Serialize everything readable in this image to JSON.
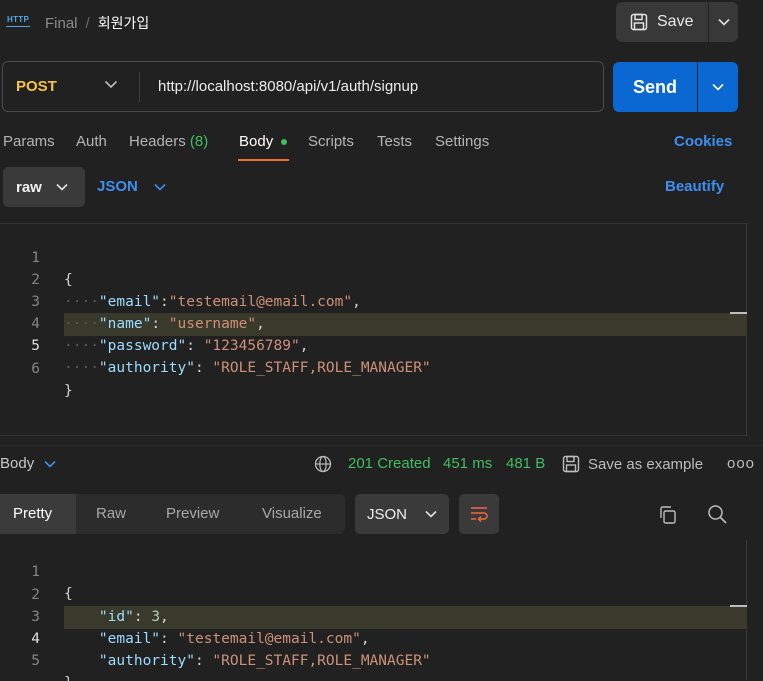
{
  "header": {
    "icon_label": "HTTP",
    "breadcrumb_parent": "Final",
    "breadcrumb_sep": "/",
    "breadcrumb_current": "회원가입",
    "save_label": "Save"
  },
  "request": {
    "method": "POST",
    "url": "http://localhost:8080/api/v1/auth/signup",
    "send_label": "Send"
  },
  "tabs": {
    "params": "Params",
    "auth": "Auth",
    "headers": "Headers",
    "headers_count": "(8)",
    "body": "Body",
    "scripts": "Scripts",
    "tests": "Tests",
    "settings": "Settings",
    "cookies": "Cookies",
    "active": "Body"
  },
  "body_options": {
    "mode": "raw",
    "format": "JSON",
    "beautify": "Beautify"
  },
  "request_body": {
    "line_numbers": [
      "1",
      "2",
      "3",
      "4",
      "5",
      "6"
    ],
    "active_line": 5,
    "open_brace": "{",
    "close_brace": "}",
    "fields": [
      {
        "key": "\"email\"",
        "colon": ":",
        "value": "\"testemail@email.com\"",
        "comma": ","
      },
      {
        "key": "\"name\"",
        "colon": ": ",
        "value": "\"username\"",
        "comma": ","
      },
      {
        "key": "\"password\"",
        "colon": ": ",
        "value": "\"123456789\"",
        "comma": ","
      },
      {
        "key": "\"authority\"",
        "colon": ": ",
        "value": "\"ROLE_STAFF,ROLE_MANAGER\"",
        "comma": ""
      }
    ]
  },
  "response": {
    "section_label": "Body",
    "status": "201 Created",
    "time": "451 ms",
    "size": "481 B",
    "save_example": "Save as example",
    "more": "ooo",
    "view_tabs": [
      "Pretty",
      "Raw",
      "Preview",
      "Visualize"
    ],
    "active_view": "Pretty",
    "format": "JSON",
    "line_numbers": [
      "1",
      "2",
      "3",
      "4",
      "5"
    ],
    "active_line": 4,
    "open_brace": "{",
    "close_brace": "}",
    "fields": [
      {
        "key": "\"id\"",
        "colon": ": ",
        "value": "3",
        "comma": ","
      },
      {
        "key": "\"email\"",
        "colon": ": ",
        "value": "\"testemail@email.com\"",
        "comma": ","
      },
      {
        "key": "\"authority\"",
        "colon": ": ",
        "value": "\"ROLE_STAFF,ROLE_MANAGER\"",
        "comma": ""
      }
    ]
  },
  "colors": {
    "method": "#f6c343",
    "accent_blue": "#0b68d3",
    "link_blue": "#3d8ef0",
    "status_green": "#3fbf5f",
    "active_tab_underline": "#f26b3a"
  },
  "icons": {
    "app": "http-icon",
    "save": "floppy-disk-icon",
    "globe": "globe-icon",
    "copy": "copy-icon",
    "search": "search-icon",
    "wrap": "wrap-lines-icon"
  }
}
